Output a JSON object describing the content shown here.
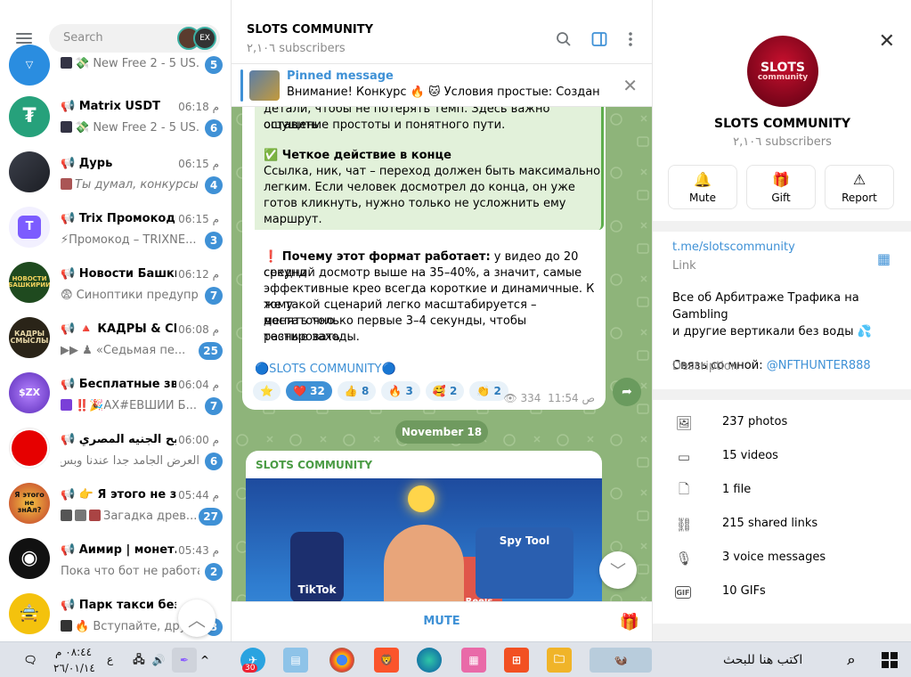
{
  "left": {
    "search_placeholder": "Search",
    "story_label": "EX",
    "chats": [
      {
        "name": "",
        "time": "",
        "preview": "💸 New Free 2 - 5 US...",
        "badge": "5",
        "avatar_color": "#2a8de0",
        "avatar_text": "▽"
      },
      {
        "name": "Matrix USDT",
        "time": "06:18 م",
        "preview": "💸 New Free 2 - 5 US...",
        "badge": "6",
        "avatar_color": "#26a17b",
        "avatar_text": "₮"
      },
      {
        "name": "Дурь",
        "time": "06:15 م",
        "preview": "Ты думал, конкурсы в...",
        "badge": "4",
        "avatar_color": "#2b2f3a",
        "avatar_text": ""
      },
      {
        "name": "Trix Промокоды",
        "time": "06:15 م",
        "preview": "⚡Промокод – TRIXNE...",
        "badge": "3",
        "avatar_color": "#7c5cff",
        "avatar_text": "T"
      },
      {
        "name": "Новости Башки...",
        "time": "06:12 م",
        "preview": "😨 Синоптики предупр...",
        "badge": "7",
        "avatar_color": "#1f4a1f",
        "avatar_text": "НОВОСТИ БАШКИРИИ"
      },
      {
        "name": "🔺 КАДРЫ & СМ...",
        "time": "06:08 م",
        "preview": "▶▶ ♟ «Седьмая пе...",
        "badge": "25",
        "avatar_color": "#2a2418",
        "avatar_text": "КАДРЫ СМЫСЛЫ"
      },
      {
        "name": "Бесплатные звё...",
        "time": "06:04 م",
        "preview": "‼️🎉АХ#ЕВШИЙ Б...",
        "badge": "7",
        "avatar_color": "#7a3fd8",
        "avatar_text": "$ZX"
      },
      {
        "name": "ربح الجنيه المصري",
        "time": "06:00 م",
        "preview": "العرض الجامد جدا عندنا وبس...",
        "badge": "6",
        "avatar_color": "#e60000",
        "avatar_text": "◯"
      },
      {
        "name": "👉 Я этого не з...",
        "time": "05:44 م",
        "preview": "Загадка древ...",
        "badge": "27",
        "avatar_color": "#d9442e",
        "avatar_text": "Я этого не знАл?"
      },
      {
        "name": "Аимир | монет...",
        "time": "05:43 م",
        "preview": "Пока что бот не работа...",
        "badge": "2",
        "avatar_color": "#111111",
        "avatar_text": "◉"
      },
      {
        "name": "Парк такси без ...",
        "time": "",
        "preview": "🔥 Вступайте, дру...",
        "badge": "3",
        "avatar_color": "#f4c20d",
        "avatar_text": "🚖"
      }
    ]
  },
  "channel": {
    "title": "SLOTS COMMUNITY",
    "subscribers": "٢,١٠٦ subscribers",
    "pinned_title": "Pinned message",
    "pinned_text": "Внимание! Конкурс 🔥 🐱 Условия простые: Создан...",
    "post_quote_lines": [
      "детали, чтобы не потерять темп. Здесь важно оставить",
      "ощущение простоты и понятного пути."
    ],
    "post_heading2": "✅ Четкое действие в конце",
    "post_body2": [
      "Ссылка, ник, чат – переход должен быть максимально",
      "легким. Если человек досмотрел до конца, он уже",
      "готов кликнуть, нужно только не усложнить ему",
      "маршрут."
    ],
    "post_heading3": "❗ Почему этот формат работает:",
    "post_body3_first": " у видео до 20 секунд",
    "post_body3": [
      "средний досмотр выше на 35–40%, а значит, самые",
      "эффективные крео всегда короткие и динамичные. К тому",
      "же такой сценарий легко масштабируется – достаточно",
      "менять только первые 3–4 секунды, чтобы тестировать",
      "разные заходы."
    ],
    "signature": "🔵SLOTS COMMUNITY🔵",
    "reactions": [
      {
        "emoji": "⭐",
        "count": ""
      },
      {
        "emoji": "❤️",
        "count": "32"
      },
      {
        "emoji": "👍",
        "count": "8"
      },
      {
        "emoji": "🔥",
        "count": "3"
      },
      {
        "emoji": "🥰",
        "count": "2"
      },
      {
        "emoji": "👏",
        "count": "2"
      }
    ],
    "views": "334",
    "time": "11:54 ص",
    "date_pill": "November 18",
    "post2_author": "SLOTS COMMUNITY",
    "post2_labels": [
      "TikTok",
      "Reels",
      "Spy Tool"
    ],
    "mute_label": "MUTE"
  },
  "info": {
    "name": "SLOTS COMMUNITY",
    "subscribers": "٢,١٠٦ subscribers",
    "avatar_text_1": "SLOTS",
    "avatar_text_2": "community",
    "actions": [
      {
        "label": "Mute",
        "icon": "bell-icon"
      },
      {
        "label": "Gift",
        "icon": "gift-icon"
      },
      {
        "label": "Report",
        "icon": "report-icon"
      }
    ],
    "link": "t.me/slotscommunity",
    "link_caption": "Link",
    "description_lines": [
      "Все об Арбитраже Трафика на Gambling",
      "и другие вертикали без воды 💦"
    ],
    "contact_prefix": "Связь со мной: ",
    "contact_handle": "@NFTHUNTER888",
    "description_caption": "Description",
    "media": [
      {
        "label": "237 photos",
        "icon": "photo-icon"
      },
      {
        "label": "15 videos",
        "icon": "video-icon"
      },
      {
        "label": "1 file",
        "icon": "file-icon"
      },
      {
        "label": "215 shared links",
        "icon": "link-icon"
      },
      {
        "label": "3 voice messages",
        "icon": "mic-icon"
      },
      {
        "label": "10 GIFs",
        "icon": "gif-icon"
      }
    ]
  },
  "taskbar": {
    "time": "٠٨:٤٤ م",
    "date": "٢٦/٠١/١٤",
    "lang": "ع",
    "telegram_badge": "30",
    "search_placeholder": "اكتب هنا للبحث"
  }
}
